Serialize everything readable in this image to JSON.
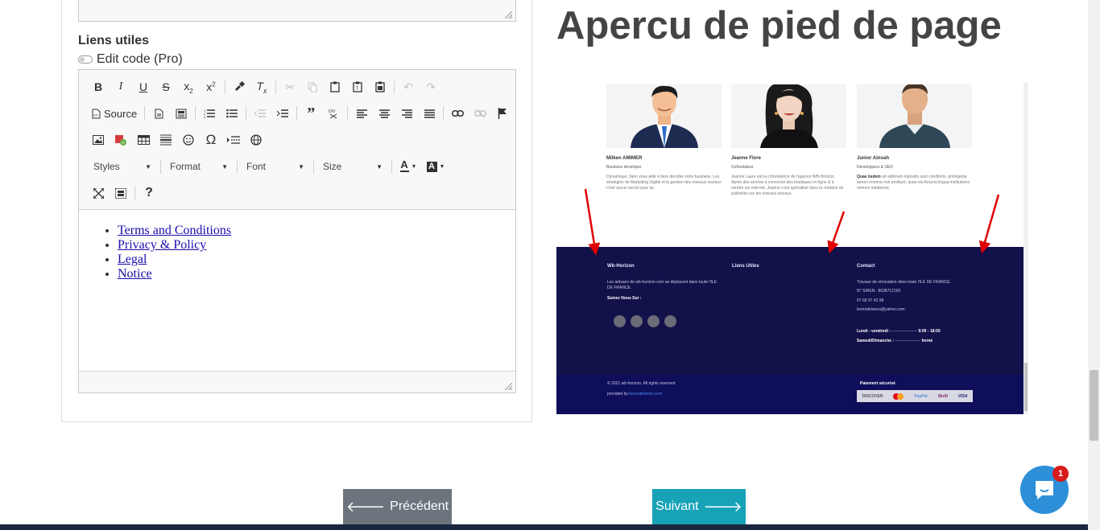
{
  "left": {
    "section_label": "Liens utiles",
    "edit_code_label": "Edit code (Pro)",
    "toolbar": {
      "source_label": "Source",
      "styles_label": "Styles",
      "format_label": "Format",
      "font_label": "Font",
      "size_label": "Size",
      "text_color_glyph": "A",
      "help_glyph": "?"
    },
    "links": [
      "Terms and Conditions",
      "Privacy & Policy",
      "Legal",
      "Notice"
    ]
  },
  "preview": {
    "title": "Apercu de pied de page",
    "team": [
      {
        "name": "Milken AMIMER",
        "role": "Business developer",
        "desc": "Dynamique, Ilann vous aide à faire décoller votre business. Les stratégies de Marketing Digital et la gestion des réseaux sociaux n'ont aucun secret pour lui."
      },
      {
        "name": "Jeanne Flore",
        "role": "Cofondateur",
        "desc": "Jeanne Laure est la cofondatrice de l'agence WB-Horizon. Après des années à concevoir des boutiques en ligne & à vendre sur internet, Jeanne s'est spécialisé dans la création de publicités sur les réseaux sociaux."
      },
      {
        "name": "Junior Ainoah",
        "role": "Développeur & SEO",
        "desc_bold": "Quae iisdem",
        "desc": "ad arbitrium inpositis sunt conditoris, primigenia tamen nomina non amittunt, quae eis Assyria lingua institutores veteres indiderunt."
      }
    ],
    "footer": {
      "col1_title": "Wb-Horizon",
      "col1_text": "Les artisans de wb-horizon.com se déplacent dans toute l'ILE DE FRANCE.",
      "follow_label": "Suivez Nous Sur :",
      "col2_title": "Liens Utiles",
      "col3_title": "Contact",
      "contact_line1": "Travaux de rénovation dans toute l'ILE DE FRANCE.",
      "contact_line2": "N° SIREN : 8638712160",
      "contact_phone": "07 68 97 42 98",
      "contact_email": "leonodelanno@yahoo.com",
      "hours_line1_label": "Lundi - vendredi :",
      "hours_line1_dashes": "-------------------",
      "hours_line1_value": "9:00 - 18:00",
      "hours_line2_label": "Samedi/Dimanche :",
      "hours_line2_dashes": "-------------------",
      "hours_line2_value": "fermé",
      "copyright": "© 2021 wb-horizon. All rights reserved",
      "provided_prefix": "provided by",
      "provided_link": "leonodelanno.com",
      "payment_label": "Paiement sécurisé",
      "payment_methods": [
        "DISCOVER",
        "MC",
        "PayPal",
        "Skrill",
        "VISA"
      ]
    }
  },
  "nav": {
    "prev_label": "Précédent",
    "next_label": "Suivant"
  },
  "chat": {
    "badge_count": "1"
  }
}
